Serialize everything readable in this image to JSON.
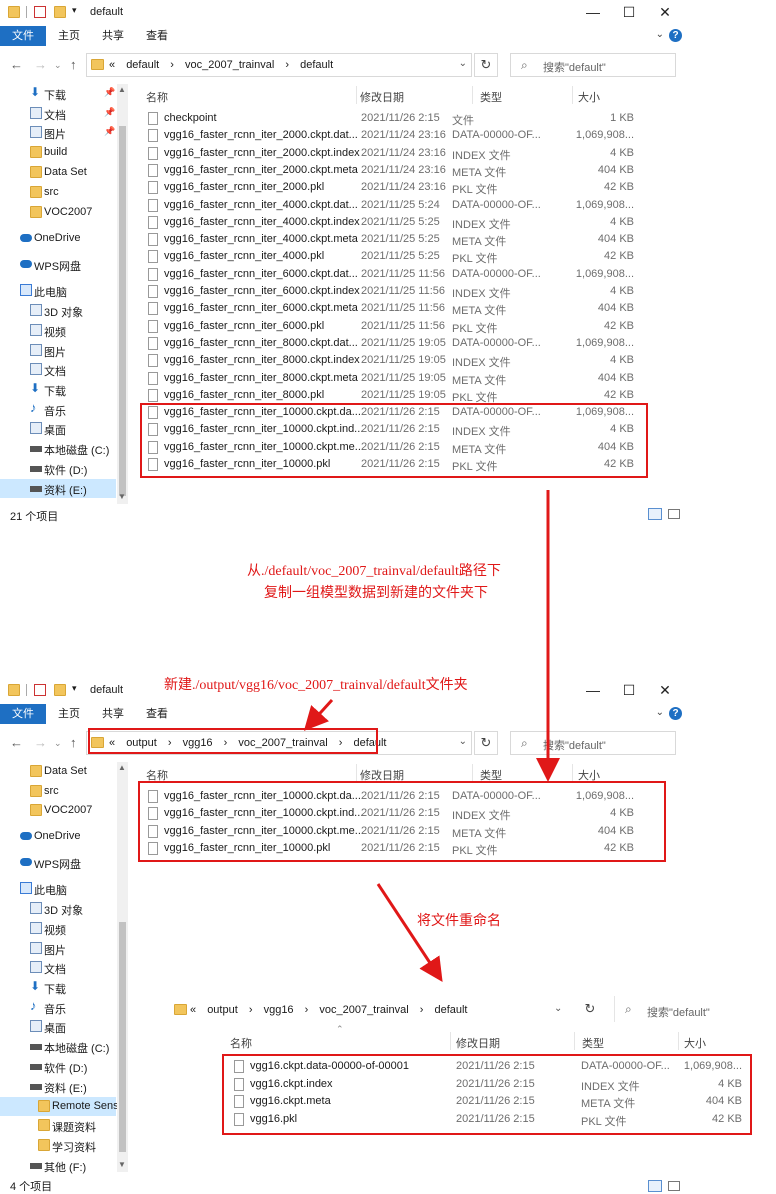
{
  "icons": {
    "folder": "folder-icon",
    "file": "file-icon",
    "arrow": "red-arrow",
    "drive": "drive-icon",
    "cloud": "onedrive-icon",
    "pc": "pc-icon"
  },
  "colors": {
    "accent": "#1e6fc3",
    "annotation": "#e01818",
    "folder": "#f2c55c"
  },
  "window1": {
    "title": "default",
    "ribbon": [
      "文件",
      "主页",
      "共享",
      "查看"
    ],
    "crumbs": [
      "«",
      "default",
      "›",
      "voc_2007_trainval",
      "›",
      "default"
    ],
    "search_placeholder": "搜索\"default\"",
    "columns": [
      "名称",
      "修改日期",
      "类型",
      "大小"
    ],
    "sidebar": [
      {
        "label": "下载",
        "pin": "📌"
      },
      {
        "label": "文档",
        "pin": "📌"
      },
      {
        "label": "图片",
        "pin": "📌"
      },
      {
        "label": "build"
      },
      {
        "label": "Data Set"
      },
      {
        "label": "src"
      },
      {
        "label": "VOC2007"
      },
      {
        "label": "OneDrive"
      },
      {
        "label": "WPS网盘"
      },
      {
        "label": "此电脑"
      },
      {
        "label": "3D 对象"
      },
      {
        "label": "视频"
      },
      {
        "label": "图片"
      },
      {
        "label": "文档"
      },
      {
        "label": "下载"
      },
      {
        "label": "音乐"
      },
      {
        "label": "桌面"
      },
      {
        "label": "本地磁盘 (C:)"
      },
      {
        "label": "软件 (D:)"
      },
      {
        "label": "资料 (E:)"
      }
    ],
    "files": [
      {
        "name": "checkpoint",
        "date": "2021/11/26 2:15",
        "type": "文件",
        "size": "1 KB"
      },
      {
        "name": "vgg16_faster_rcnn_iter_2000.ckpt.dat...",
        "date": "2021/11/24 23:16",
        "type": "DATA-00000-OF...",
        "size": "1,069,908..."
      },
      {
        "name": "vgg16_faster_rcnn_iter_2000.ckpt.index",
        "date": "2021/11/24 23:16",
        "type": "INDEX 文件",
        "size": "4 KB"
      },
      {
        "name": "vgg16_faster_rcnn_iter_2000.ckpt.meta",
        "date": "2021/11/24 23:16",
        "type": "META 文件",
        "size": "404 KB"
      },
      {
        "name": "vgg16_faster_rcnn_iter_2000.pkl",
        "date": "2021/11/24 23:16",
        "type": "PKL 文件",
        "size": "42 KB"
      },
      {
        "name": "vgg16_faster_rcnn_iter_4000.ckpt.dat...",
        "date": "2021/11/25 5:24",
        "type": "DATA-00000-OF...",
        "size": "1,069,908..."
      },
      {
        "name": "vgg16_faster_rcnn_iter_4000.ckpt.index",
        "date": "2021/11/25 5:25",
        "type": "INDEX 文件",
        "size": "4 KB"
      },
      {
        "name": "vgg16_faster_rcnn_iter_4000.ckpt.meta",
        "date": "2021/11/25 5:25",
        "type": "META 文件",
        "size": "404 KB"
      },
      {
        "name": "vgg16_faster_rcnn_iter_4000.pkl",
        "date": "2021/11/25 5:25",
        "type": "PKL 文件",
        "size": "42 KB"
      },
      {
        "name": "vgg16_faster_rcnn_iter_6000.ckpt.dat...",
        "date": "2021/11/25 11:56",
        "type": "DATA-00000-OF...",
        "size": "1,069,908..."
      },
      {
        "name": "vgg16_faster_rcnn_iter_6000.ckpt.index",
        "date": "2021/11/25 11:56",
        "type": "INDEX 文件",
        "size": "4 KB"
      },
      {
        "name": "vgg16_faster_rcnn_iter_6000.ckpt.meta",
        "date": "2021/11/25 11:56",
        "type": "META 文件",
        "size": "404 KB"
      },
      {
        "name": "vgg16_faster_rcnn_iter_6000.pkl",
        "date": "2021/11/25 11:56",
        "type": "PKL 文件",
        "size": "42 KB"
      },
      {
        "name": "vgg16_faster_rcnn_iter_8000.ckpt.dat...",
        "date": "2021/11/25 19:05",
        "type": "DATA-00000-OF...",
        "size": "1,069,908..."
      },
      {
        "name": "vgg16_faster_rcnn_iter_8000.ckpt.index",
        "date": "2021/11/25 19:05",
        "type": "INDEX 文件",
        "size": "4 KB"
      },
      {
        "name": "vgg16_faster_rcnn_iter_8000.ckpt.meta",
        "date": "2021/11/25 19:05",
        "type": "META 文件",
        "size": "404 KB"
      },
      {
        "name": "vgg16_faster_rcnn_iter_8000.pkl",
        "date": "2021/11/25 19:05",
        "type": "PKL 文件",
        "size": "42 KB"
      },
      {
        "name": "vgg16_faster_rcnn_iter_10000.ckpt.da...",
        "date": "2021/11/26 2:15",
        "type": "DATA-00000-OF...",
        "size": "1,069,908..."
      },
      {
        "name": "vgg16_faster_rcnn_iter_10000.ckpt.ind...",
        "date": "2021/11/26 2:15",
        "type": "INDEX 文件",
        "size": "4 KB"
      },
      {
        "name": "vgg16_faster_rcnn_iter_10000.ckpt.me...",
        "date": "2021/11/26 2:15",
        "type": "META 文件",
        "size": "404 KB"
      },
      {
        "name": "vgg16_faster_rcnn_iter_10000.pkl",
        "date": "2021/11/26 2:15",
        "type": "PKL 文件",
        "size": "42 KB"
      }
    ],
    "status": "21 个项目"
  },
  "annotation1": {
    "line1": "从./default/voc_2007_trainval/default路径下",
    "line2": "复制一组模型数据到新建的文件夹下"
  },
  "annotation2": "新建./output/vgg16/voc_2007_trainval/default文件夹",
  "annotation3": "将文件重命名",
  "window2": {
    "title": "default",
    "ribbon": [
      "文件",
      "主页",
      "共享",
      "查看"
    ],
    "crumbs": [
      "«",
      "output",
      "›",
      "vgg16",
      "›",
      "voc_2007_trainval",
      "›",
      "default"
    ],
    "search_placeholder": "搜索\"default\"",
    "columns": [
      "名称",
      "修改日期",
      "类型",
      "大小"
    ],
    "sidebar": [
      {
        "label": "Data Set"
      },
      {
        "label": "src"
      },
      {
        "label": "VOC2007"
      },
      {
        "label": "OneDrive"
      },
      {
        "label": "WPS网盘"
      },
      {
        "label": "此电脑"
      },
      {
        "label": "3D 对象"
      },
      {
        "label": "视频"
      },
      {
        "label": "图片"
      },
      {
        "label": "文档"
      },
      {
        "label": "下载"
      },
      {
        "label": "音乐"
      },
      {
        "label": "桌面"
      },
      {
        "label": "本地磁盘 (C:)"
      },
      {
        "label": "软件 (D:)"
      },
      {
        "label": "资料 (E:)"
      },
      {
        "label": "Remote Sensi"
      },
      {
        "label": "课题资料"
      },
      {
        "label": "学习资料"
      },
      {
        "label": "其他 (F:)"
      }
    ],
    "files": [
      {
        "name": "vgg16_faster_rcnn_iter_10000.ckpt.da...",
        "date": "2021/11/26 2:15",
        "type": "DATA-00000-OF...",
        "size": "1,069,908..."
      },
      {
        "name": "vgg16_faster_rcnn_iter_10000.ckpt.ind...",
        "date": "2021/11/26 2:15",
        "type": "INDEX 文件",
        "size": "4 KB"
      },
      {
        "name": "vgg16_faster_rcnn_iter_10000.ckpt.me...",
        "date": "2021/11/26 2:15",
        "type": "META 文件",
        "size": "404 KB"
      },
      {
        "name": "vgg16_faster_rcnn_iter_10000.pkl",
        "date": "2021/11/26 2:15",
        "type": "PKL 文件",
        "size": "42 KB"
      }
    ],
    "status": "4 个项目"
  },
  "panel3": {
    "crumbs": [
      "«",
      "output",
      "›",
      "vgg16",
      "›",
      "voc_2007_trainval",
      "›",
      "default"
    ],
    "search_placeholder": "搜索\"default\"",
    "columns": [
      "名称",
      "修改日期",
      "类型",
      "大小"
    ],
    "files": [
      {
        "name": "vgg16.ckpt.data-00000-of-00001",
        "date": "2021/11/26 2:15",
        "type": "DATA-00000-OF...",
        "size": "1,069,908..."
      },
      {
        "name": "vgg16.ckpt.index",
        "date": "2021/11/26 2:15",
        "type": "INDEX 文件",
        "size": "4 KB"
      },
      {
        "name": "vgg16.ckpt.meta",
        "date": "2021/11/26 2:15",
        "type": "META 文件",
        "size": "404 KB"
      },
      {
        "name": "vgg16.pkl",
        "date": "2021/11/26 2:15",
        "type": "PKL 文件",
        "size": "42 KB"
      }
    ]
  }
}
